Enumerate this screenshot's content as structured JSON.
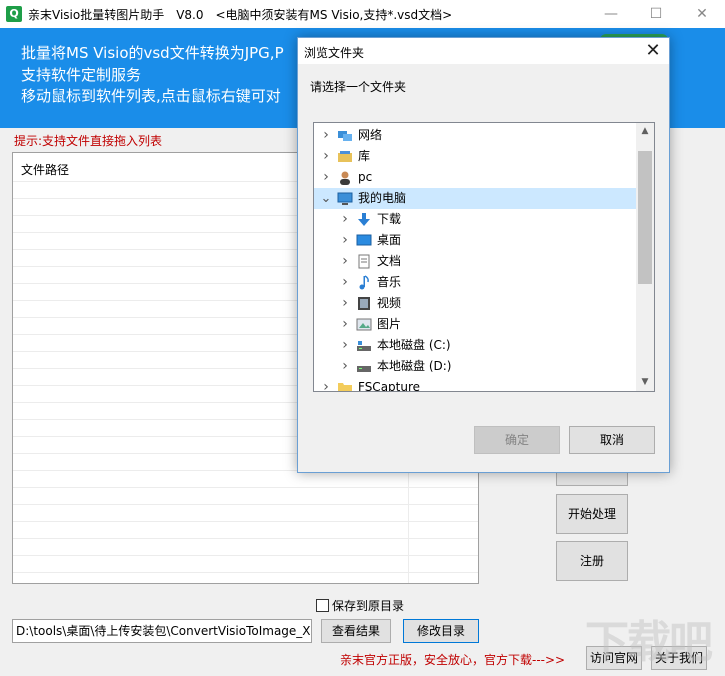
{
  "app": {
    "title": "亲末Visio批量转图片助手　V8.0　<电脑中须安装有MS Visio,支持*.vsd文档>",
    "icon_letter": "Q",
    "controls": {
      "minimize": "—",
      "maximize": "☐",
      "close": "✕"
    }
  },
  "banner": {
    "lines": [
      "批量将MS Visio的vsd文件转换为JPG,P",
      "支持软件定制服务",
      "移动鼠标到软件列表,点击鼠标右键可对"
    ]
  },
  "hint": "提示:支持文件直接拖入列表",
  "file_list": {
    "column_header": "文件路径"
  },
  "side_buttons": {
    "start": "开始处理",
    "register": "注册"
  },
  "bottom": {
    "save_to_original_label": "保存到原目录",
    "path_value": "D:\\tools\\桌面\\待上传安装包\\ConvertVisioToImage_Xia",
    "view_results": "查看结果",
    "change_dir": "修改目录",
    "footer_text": "亲末官方正版，安全放心，官方下载--->>",
    "visit_site": "访问官网",
    "about_us": "关于我们"
  },
  "dialog": {
    "title": "浏览文件夹",
    "close": "✕",
    "prompt": "请选择一个文件夹",
    "tree": [
      {
        "label": "网络",
        "icon": "network-icon",
        "level": 0,
        "expanded": false
      },
      {
        "label": "库",
        "icon": "library-icon",
        "level": 0,
        "expanded": false
      },
      {
        "label": "pc",
        "icon": "user-icon",
        "level": 0,
        "expanded": false
      },
      {
        "label": "我的电脑",
        "icon": "computer-icon",
        "level": 0,
        "expanded": true,
        "selected": true
      },
      {
        "label": "下载",
        "icon": "download-icon",
        "level": 1,
        "expanded": false
      },
      {
        "label": "桌面",
        "icon": "desktop-icon",
        "level": 1,
        "expanded": false
      },
      {
        "label": "文档",
        "icon": "document-icon",
        "level": 1,
        "expanded": false
      },
      {
        "label": "音乐",
        "icon": "music-icon",
        "level": 1,
        "expanded": false
      },
      {
        "label": "视频",
        "icon": "video-icon",
        "level": 1,
        "expanded": false
      },
      {
        "label": "图片",
        "icon": "picture-icon",
        "level": 1,
        "expanded": false
      },
      {
        "label": "本地磁盘 (C:)",
        "icon": "drive-c-icon",
        "level": 1,
        "expanded": false
      },
      {
        "label": "本地磁盘 (D:)",
        "icon": "drive-d-icon",
        "level": 1,
        "expanded": false
      },
      {
        "label": "FSCapture",
        "icon": "folder-icon",
        "level": 0,
        "expanded": false
      }
    ],
    "ok": "确定",
    "cancel": "取消"
  },
  "watermark": "下载吧",
  "colors": {
    "banner": "#1a8de9",
    "hint": "#c00000",
    "selection": "#cce8ff"
  }
}
